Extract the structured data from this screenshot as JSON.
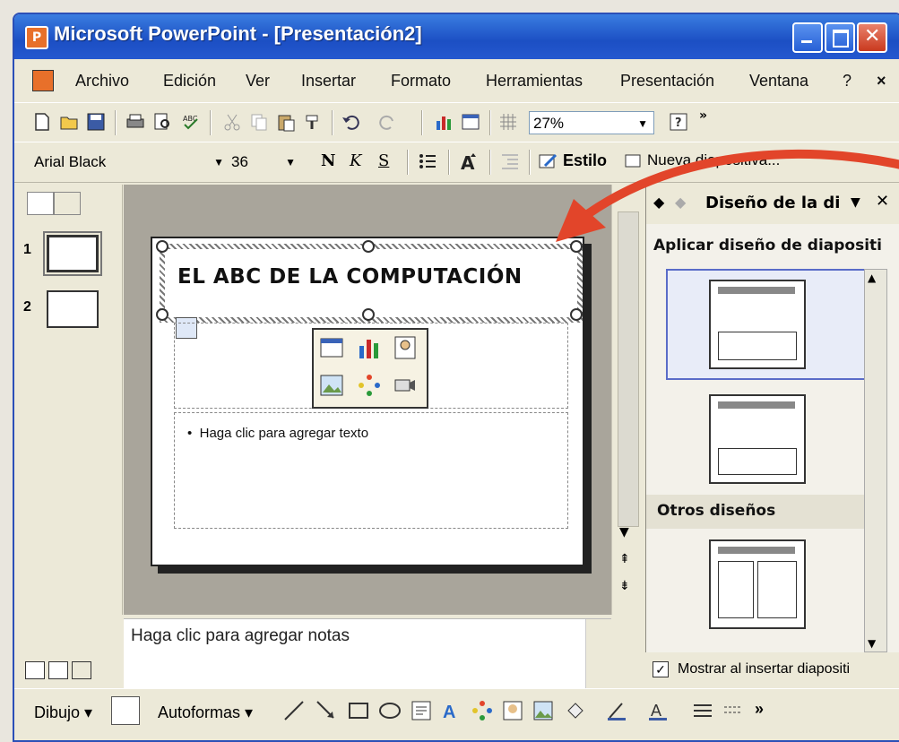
{
  "window": {
    "title": "Microsoft PowerPoint - [Presentación2]"
  },
  "menu": {
    "items": [
      "Archivo",
      "Edición",
      "Ver",
      "Insertar",
      "Formato",
      "Herramientas",
      "Presentación",
      "Ventana",
      "?"
    ],
    "close": "×"
  },
  "standard_toolbar": {
    "zoom": "27%"
  },
  "format_toolbar": {
    "font_name": "Arial Black",
    "font_size": "36",
    "bold": "N",
    "italic": "K",
    "underline": "S",
    "style_label": "Estilo",
    "new_slide_label": "Nueva diapositiva..."
  },
  "outline": {
    "slides": [
      "1",
      "2"
    ]
  },
  "slide": {
    "title": "EL ABC DE LA COMPUTACIÓN",
    "body_placeholder": "Haga clic para agregar texto",
    "bullet": "•"
  },
  "notes": {
    "placeholder": "Haga clic para agregar notas"
  },
  "task_pane": {
    "title": "Diseño de la di",
    "apply_label": "Aplicar diseño de diapositi",
    "other_label": "Otros diseños",
    "show_label": "Mostrar al insertar diapositi"
  },
  "drawing_toolbar": {
    "draw_label": "Dibujo",
    "autoshapes_label": "Autoformas"
  },
  "colors": {
    "accent_arrow": "#e2452a",
    "title_bar": "#2458cf"
  }
}
